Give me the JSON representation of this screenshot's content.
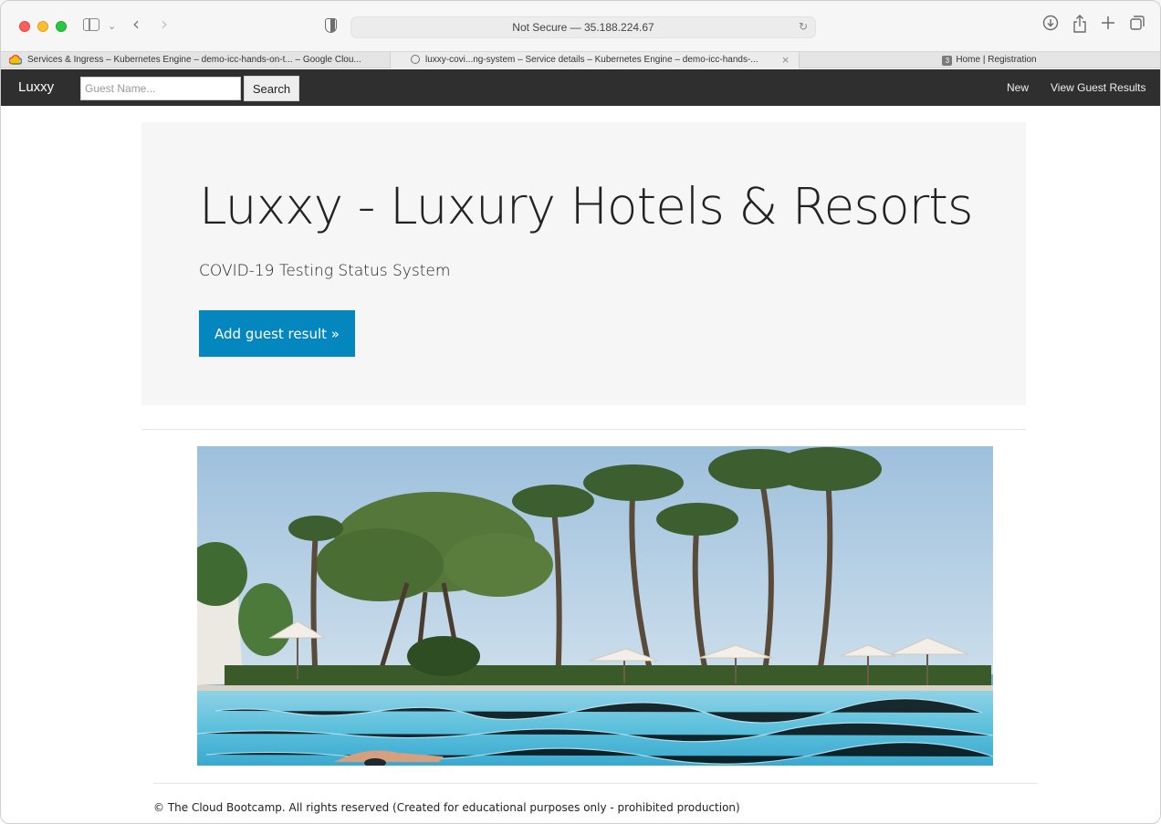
{
  "browser": {
    "address": "Not Secure — 35.188.224.67",
    "tabs": [
      {
        "label": "Services & Ingress – Kubernetes Engine – demo-icc-hands-on-t... – Google Clou..."
      },
      {
        "label": "luxxy-covi...ng-system – Service details – Kubernetes Engine – demo-icc-hands-..."
      },
      {
        "label": "Home | Registration",
        "badge": "3"
      }
    ],
    "close_glyph": "×"
  },
  "navbar": {
    "brand": "Luxxy",
    "search_placeholder": "Guest Name...",
    "search_label": "Search",
    "links": [
      "New",
      "View Guest Results"
    ]
  },
  "jumbotron": {
    "title": "Luxxy - Luxury Hotels & Resorts",
    "subtitle": "COVID-19 Testing Status System",
    "cta_label": "Add guest result »",
    "cta_color": "#0486be"
  },
  "footer": {
    "text": "© The Cloud Bootcamp. All rights reserved (Created for educational purposes only - prohibited production)"
  },
  "icons": [
    "sidebar-icon",
    "chevron-down-icon",
    "back-icon",
    "forward-icon",
    "shield-icon",
    "reload-icon",
    "download-icon",
    "share-icon",
    "new-tab-icon",
    "tab-overview-icon"
  ]
}
